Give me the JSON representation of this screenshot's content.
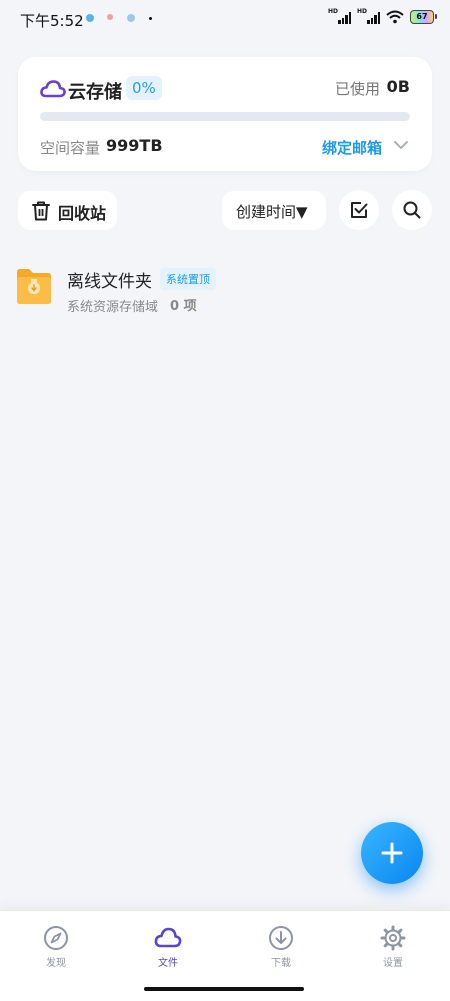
{
  "status_bar": {
    "time": "下午5:52",
    "battery": "67",
    "hd1": "HD",
    "hd2": "HD"
  },
  "storage": {
    "title": "云存储",
    "percent": "0%",
    "percent_value": 0,
    "used_label": "已使用",
    "used_value": "0B",
    "capacity_label": "空间容量",
    "capacity_value": "999TB",
    "bind_email": "绑定邮箱"
  },
  "toolbar": {
    "recycle_bin": "回收站",
    "sort_label": "创建时间▼"
  },
  "files": [
    {
      "name": "离线文件夹",
      "badge": "系统置顶",
      "description": "系统资源存储域",
      "count": "0 项"
    }
  ],
  "bottom_nav": [
    {
      "label": "发现",
      "icon": "compass-icon"
    },
    {
      "label": "文件",
      "icon": "cloud-icon",
      "active": true
    },
    {
      "label": "下载",
      "icon": "download-icon"
    },
    {
      "label": "设置",
      "icon": "gear-icon"
    }
  ],
  "colors": {
    "accent": "#1e9be6",
    "brand_purple": "#5b45c9",
    "folder": "#f8b13a",
    "background": "#f3f5f9"
  }
}
